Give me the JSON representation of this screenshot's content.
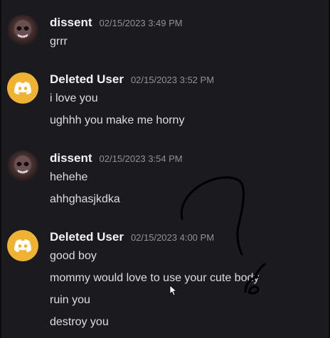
{
  "messages": [
    {
      "username": "dissent",
      "timestamp": "02/15/2023 3:49 PM",
      "avatar": "dissent-avatar",
      "lines": [
        "grrr"
      ]
    },
    {
      "username": "Deleted User",
      "timestamp": "02/15/2023 3:52 PM",
      "avatar": "discord-logo-icon",
      "lines": [
        "i love you",
        "ughhh you make me horny"
      ]
    },
    {
      "username": "dissent",
      "timestamp": "02/15/2023 3:54 PM",
      "avatar": "dissent-avatar",
      "lines": [
        "hehehe",
        "ahhghasjkdka"
      ]
    },
    {
      "username": "Deleted User",
      "timestamp": "02/15/2023 4:00 PM",
      "avatar": "discord-logo-icon",
      "lines": [
        "good boy",
        "mommy would love to use your cute body",
        "ruin you",
        "destroy you"
      ]
    }
  ],
  "colors": {
    "background": "#1b1b1f",
    "username": "#f2f3f5",
    "timestamp": "#8e9297",
    "text": "#dbdee1",
    "discord_avatar": "#f0b232"
  }
}
